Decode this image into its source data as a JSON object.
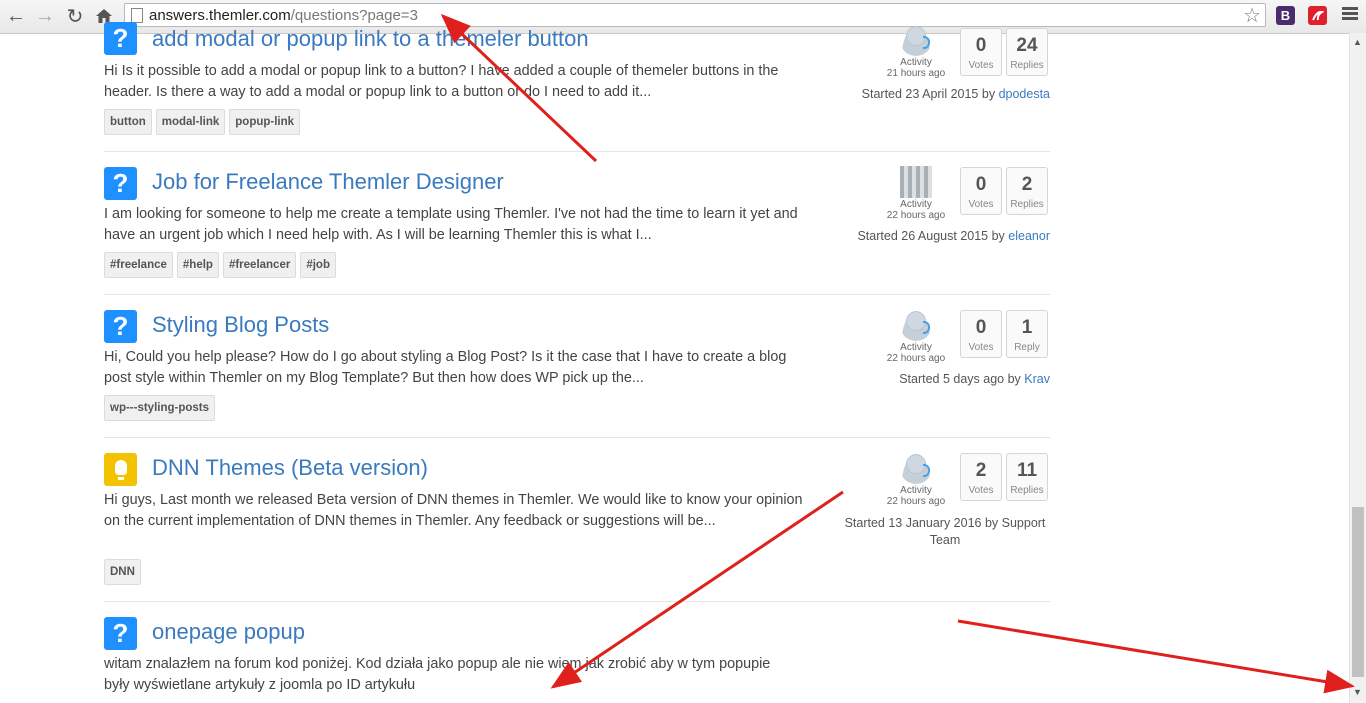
{
  "browser": {
    "url_host": "answers.themler.com",
    "url_path": "/questions?page=3",
    "back_icon": "arrow-left-icon",
    "forward_icon": "arrow-right-icon",
    "reload_icon": "reload-icon",
    "home_icon": "home-icon",
    "star_icon": "star-icon",
    "ext1_label": "B",
    "ext1_color": "#4b2a6e",
    "ext2_color": "#e0202a",
    "menu_icon": "hamburger-menu-icon"
  },
  "topics": [
    {
      "icon": "question-icon",
      "title": "add modal or popup link to a themeler button",
      "excerpt": "Hi Is it possible to add a modal or popup link to a button? I have added a couple of themeler buttons in the header. Is there a way to add a modal or popup link to a button or do I need to add it...",
      "tags": [
        "button",
        "modal-link",
        "popup-link"
      ],
      "activity_label": "Activity",
      "activity_time": "21 hours ago",
      "votes": "0",
      "votes_label": "Votes",
      "replies": "24",
      "replies_label": "Replies",
      "started": "Started 23 April 2015 by",
      "author": "dpodesta"
    },
    {
      "icon": "question-icon",
      "title": "Job for Freelance Themler Designer",
      "excerpt": "I am looking for someone to help me create a template using Themler. I've not had the time to learn it yet and have an urgent job which I need help with. As I will be learning Themler this is what I...",
      "tags": [
        "#freelance",
        "#help",
        "#freelancer",
        "#job"
      ],
      "activity_label": "Activity",
      "activity_time": "22 hours ago",
      "votes": "0",
      "votes_label": "Votes",
      "replies": "2",
      "replies_label": "Replies",
      "started": "Started 26 August 2015 by",
      "author": "eleanor"
    },
    {
      "icon": "question-icon",
      "title": "Styling Blog Posts",
      "excerpt": "Hi, Could you help please? How do I go about styling a Blog Post? Is it the case that I have to create a blog post style within Themler on my Blog Template? But then how does WP pick up the...",
      "tags": [
        "wp---styling-posts"
      ],
      "activity_label": "Activity",
      "activity_time": "22 hours ago",
      "votes": "0",
      "votes_label": "Votes",
      "replies": "1",
      "replies_label": "Reply",
      "started": "Started 5 days ago by",
      "author": "Krav"
    },
    {
      "icon": "lightbulb-icon",
      "title": "DNN Themes (Beta version)",
      "excerpt": "Hi guys, Last month we released Beta version of DNN themes in Themler. We would like to know your opinion on the current implementation of DNN themes in Themler. Any feedback or suggestions will be...",
      "tags": [
        "DNN"
      ],
      "activity_label": "Activity",
      "activity_time": "22 hours ago",
      "votes": "2",
      "votes_label": "Votes",
      "replies": "11",
      "replies_label": "Replies",
      "started": "Started 13 January 2016 by Support Team"
    },
    {
      "icon": "question-icon",
      "title": "onepage popup",
      "excerpt": "witam znalazłem na forum kod poniżej. Kod działa jako popup ale nie wiem jak zrobić aby w tym popupie były wyświetlane artykuły z joomla po ID artykułu"
    }
  ],
  "colors": {
    "question_icon": "#1e90ff",
    "idea_icon": "#f3c200",
    "link": "#3a7abf",
    "annotation_arrow": "#e0201c"
  }
}
